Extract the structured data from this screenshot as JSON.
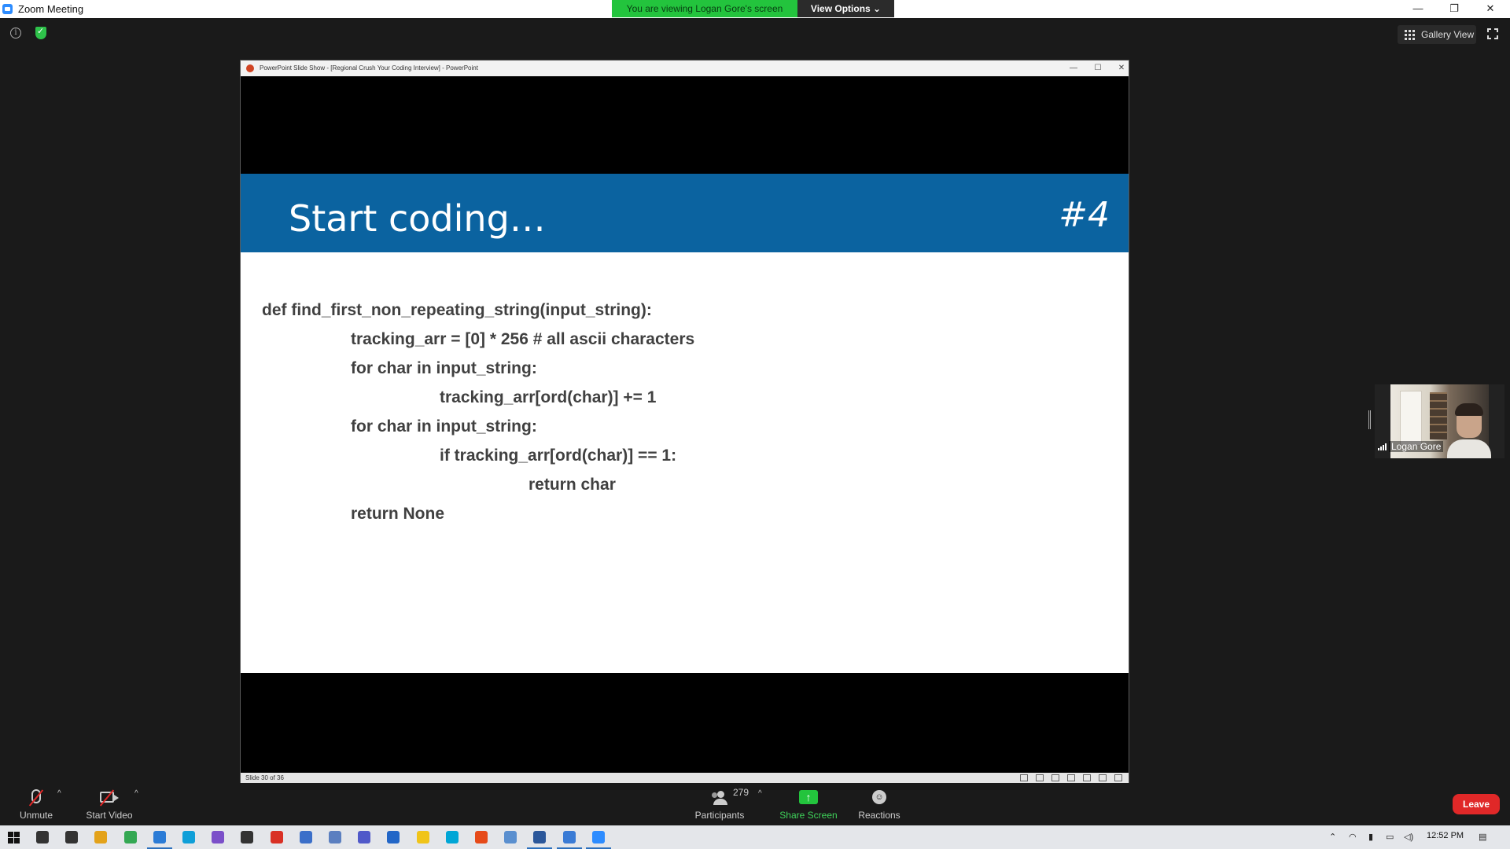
{
  "window": {
    "title": "Zoom Meeting",
    "controls": [
      "—",
      "❐",
      "✕"
    ]
  },
  "banner": {
    "viewing": "You are viewing Logan Gore's screen",
    "view_options": "View Options ⌄"
  },
  "top_right": {
    "gallery_view": "Gallery View"
  },
  "shared_window": {
    "title": "PowerPoint Slide Show - [Regional Crush Your Coding Interview] - PowerPoint",
    "controls": [
      "—",
      "☐",
      "✕"
    ],
    "status": "Slide 30 of 36"
  },
  "slide": {
    "title": "Start coding…",
    "number": "#4",
    "code_lines": [
      "def find_first_non_repeating_string(input_string):",
      "tracking_arr = [0] * 256 # all ascii characters",
      "for char in input_string:",
      "tracking_arr[ord(char)] += 1",
      "for char in input_string:",
      "if tracking_arr[ord(char)] == 1:",
      "return char",
      "return None"
    ]
  },
  "participant_video": {
    "name": "Logan Gore"
  },
  "toolbar": {
    "unmute": "Unmute",
    "start_video": "Start Video",
    "participants_count": "279",
    "participants": "Participants",
    "share_screen": "Share Screen",
    "reactions": "Reactions",
    "leave": "Leave",
    "caret": "^"
  },
  "taskbar": {
    "clock": "12:52 PM",
    "icon_colors": [
      "#333333",
      "#333333",
      "#e3a21a",
      "#34a853",
      "#2b7bd6",
      "#0f9fd8",
      "#7b4fc9",
      "#333333",
      "#d93025",
      "#3b6fc9",
      "#5b7fc0",
      "#5059c9",
      "#2266c7",
      "#f0c419",
      "#00a6d6",
      "#e64a19",
      "#5a8fcf",
      "#2b579a",
      "#3a7bd5",
      "#2d8cff"
    ]
  }
}
